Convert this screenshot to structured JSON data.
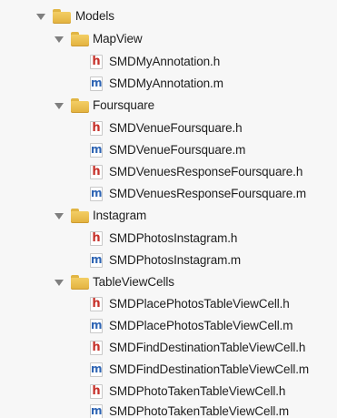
{
  "navigator": {
    "groups": {
      "models": {
        "label": "Models",
        "expanded": true,
        "icon": "folder-icon"
      },
      "mapview": {
        "label": "MapView",
        "expanded": true,
        "icon": "folder-icon",
        "files": [
          {
            "label": "SMDMyAnnotation.h",
            "type": "h",
            "icon": "header-file-icon"
          },
          {
            "label": "SMDMyAnnotation.m",
            "type": "m",
            "icon": "implementation-file-icon"
          }
        ]
      },
      "foursquare": {
        "label": "Foursquare",
        "expanded": true,
        "icon": "folder-icon",
        "files": [
          {
            "label": "SMDVenueFoursquare.h",
            "type": "h",
            "icon": "header-file-icon"
          },
          {
            "label": "SMDVenueFoursquare.m",
            "type": "m",
            "icon": "implementation-file-icon"
          },
          {
            "label": "SMDVenuesResponseFoursquare.h",
            "type": "h",
            "icon": "header-file-icon"
          },
          {
            "label": "SMDVenuesResponseFoursquare.m",
            "type": "m",
            "icon": "implementation-file-icon"
          }
        ]
      },
      "instagram": {
        "label": "Instagram",
        "expanded": true,
        "icon": "folder-icon",
        "files": [
          {
            "label": "SMDPhotosInstagram.h",
            "type": "h",
            "icon": "header-file-icon"
          },
          {
            "label": "SMDPhotosInstagram.m",
            "type": "m",
            "icon": "implementation-file-icon"
          }
        ]
      },
      "tableviewcells": {
        "label": "TableViewCells",
        "expanded": true,
        "icon": "folder-icon",
        "files": [
          {
            "label": "SMDPlacePhotosTableViewCell.h",
            "type": "h",
            "icon": "header-file-icon"
          },
          {
            "label": "SMDPlacePhotosTableViewCell.m",
            "type": "m",
            "icon": "implementation-file-icon"
          },
          {
            "label": "SMDFindDestinationTableViewCell.h",
            "type": "h",
            "icon": "header-file-icon"
          },
          {
            "label": "SMDFindDestinationTableViewCell.m",
            "type": "m",
            "icon": "implementation-file-icon"
          },
          {
            "label": "SMDPhotoTakenTableViewCell.h",
            "type": "h",
            "icon": "header-file-icon"
          },
          {
            "label": "SMDPhotoTakenTableViewCell.m",
            "type": "m",
            "icon": "implementation-file-icon"
          }
        ]
      }
    },
    "file_glyphs": {
      "h": "h",
      "m": "m"
    },
    "colors": {
      "header_glyph": "#c6312a",
      "implementation_glyph": "#2f65b4",
      "folder": "#e8bb48",
      "background": "#f7f7f7"
    }
  }
}
